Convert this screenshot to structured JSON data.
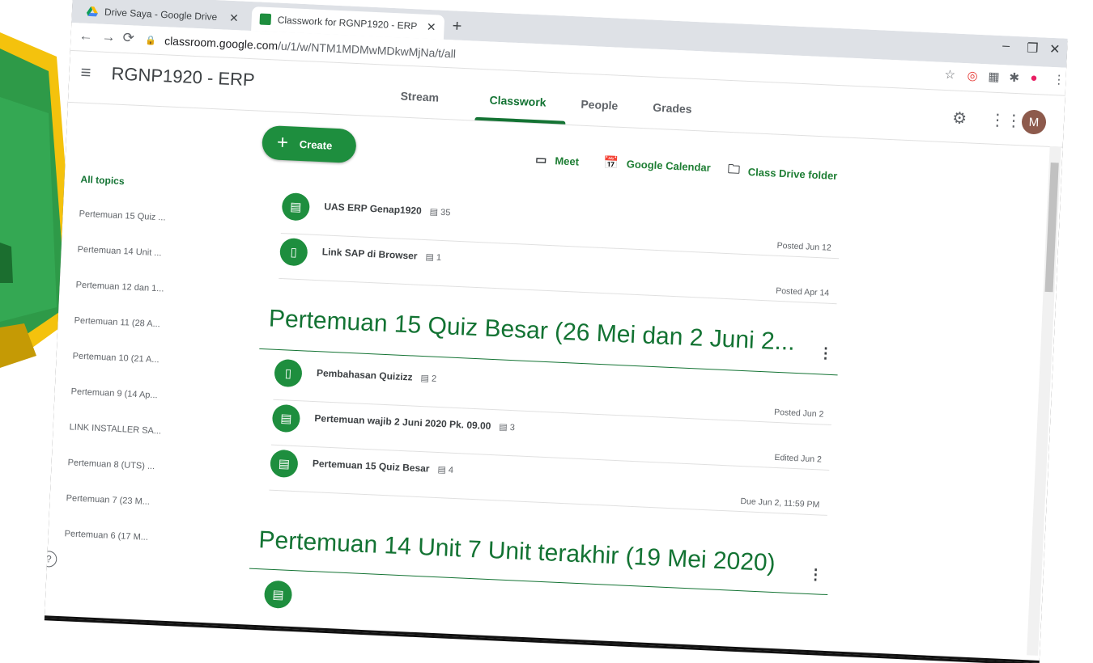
{
  "tabs": [
    {
      "title": "Drive Saya - Google Drive",
      "active": false
    },
    {
      "title": "Classwork for RGNP1920 - ERP",
      "active": true
    }
  ],
  "address": {
    "host": "classroom.google.com",
    "path": "/u/1/w/NTM1MDMwMDkwMjNa/t/all"
  },
  "app": {
    "class_name": "RGNP1920 - ERP",
    "nav": [
      "Stream",
      "Classwork",
      "People",
      "Grades"
    ],
    "active_nav": "Classwork",
    "avatar_letter": "M"
  },
  "actions": {
    "create": "Create",
    "meet": "Meet",
    "calendar": "Google Calendar",
    "drive_folder": "Class Drive folder"
  },
  "sidebar": {
    "topics": [
      "All topics",
      "Pertemuan 15 Quiz ...",
      "Pertemuan 14 Unit ...",
      "Pertemuan 12 dan 1...",
      "Pertemuan 11 (28 A...",
      "Pertemuan 10 (21 A...",
      "Pertemuan 9 (14 Ap...",
      "LINK INSTALLER SA...",
      "Pertemuan 8 (UTS) ...",
      "Pertemuan 7 (23 M...",
      "Pertemuan 6 (17 M..."
    ]
  },
  "top_items": [
    {
      "title": "UAS ERP Genap1920",
      "comments": "35",
      "status": "Posted Jun 12",
      "icon": "assignment-icon"
    },
    {
      "title": "Link SAP di Browser",
      "comments": "1",
      "status": "Posted Apr 14",
      "icon": "material-icon"
    }
  ],
  "sections": [
    {
      "title": "Pertemuan 15 Quiz Besar (26 Mei dan 2 Juni 2...",
      "items": [
        {
          "title": "Pembahasan Quizizz",
          "comments": "2",
          "status": "Posted Jun 2",
          "icon": "material-icon"
        },
        {
          "title": "Pertemuan wajib 2 Juni 2020 Pk. 09.00",
          "comments": "3",
          "status": "Edited Jun 2",
          "icon": "assignment-icon"
        },
        {
          "title": "Pertemuan 15 Quiz Besar",
          "comments": "4",
          "status": "Due Jun 2, 11:59 PM",
          "icon": "assignment-icon"
        }
      ]
    },
    {
      "title": "Pertemuan 14 Unit 7 Unit terakhir (19 Mei 2020)",
      "items": []
    }
  ],
  "colors": {
    "accent": "#137333",
    "primary_button": "#1e8e3e",
    "logo_yellow": "#f4c20d",
    "logo_green": "#2e9a48"
  }
}
